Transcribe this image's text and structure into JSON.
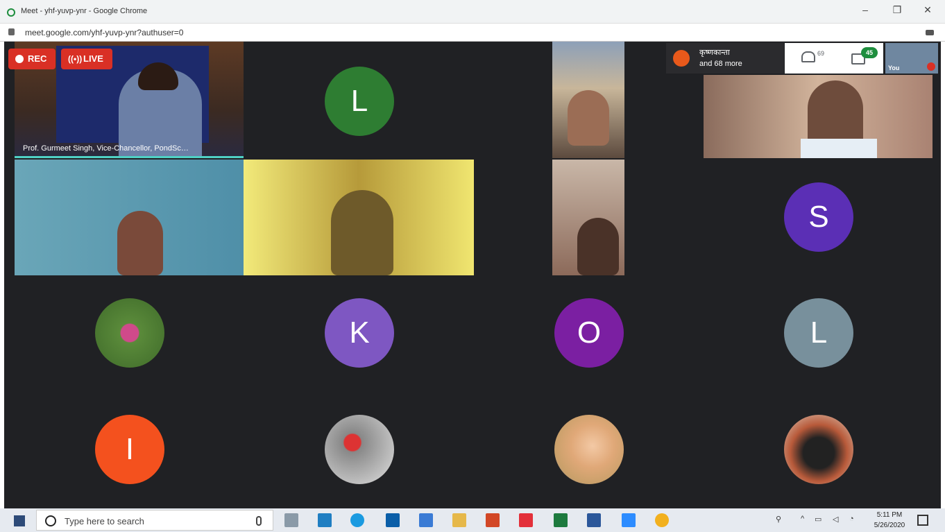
{
  "browser": {
    "title": "Meet - yhf-yuvp-ynr - Google Chrome",
    "url": "meet.google.com/yhf-yuvp-ynr?authuser=0",
    "minimize": "–",
    "restore": "❐",
    "close": "✕"
  },
  "meet": {
    "rec_label": "REC",
    "live_label": "LIVE",
    "speaker_name": "Prof. Gurmeet Singh, Vice-Chancellor, PondSc…",
    "header": {
      "presenter_line1": "कृष्णकान्ता",
      "presenter_line2": "and 68 more",
      "people_count": "69",
      "chat_badge": "45",
      "self_label": "You"
    },
    "avatars": [
      {
        "letter": "L",
        "color": "#2e7d32"
      },
      {
        "letter": "S",
        "color": "#5b2fb5"
      },
      {
        "letter": "K",
        "color": "#7e57c2"
      },
      {
        "letter": "O",
        "color": "#7b1fa2"
      },
      {
        "letter": "L",
        "color": "#78909c"
      },
      {
        "letter": "I",
        "color": "#f4511e"
      }
    ]
  },
  "taskbar": {
    "search_placeholder": "Type here to search",
    "time": "5:11 PM",
    "date": "5/26/2020"
  }
}
